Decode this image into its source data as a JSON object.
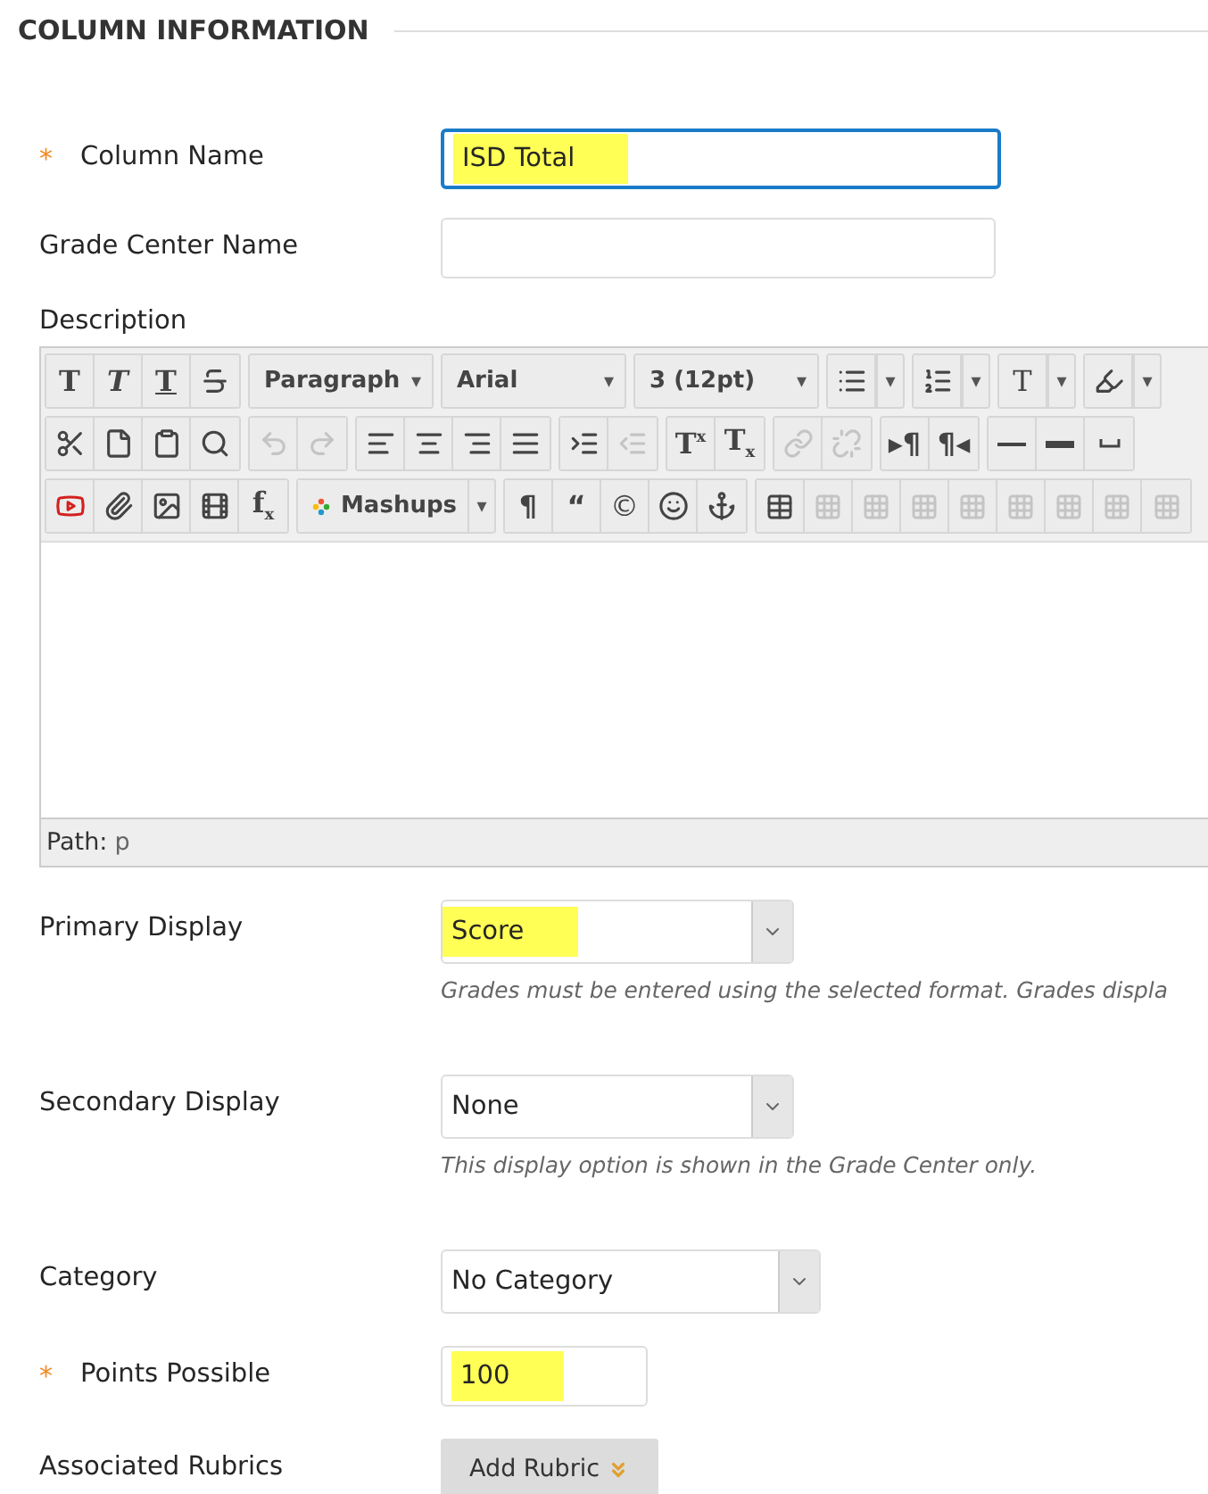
{
  "section": {
    "title": "COLUMN INFORMATION"
  },
  "fields": [
    {
      "kind": "text",
      "label": "Column Name",
      "required_mark": "*",
      "value": "ISD Total",
      "highlighted": true,
      "focused": true
    },
    {
      "kind": "text",
      "label": "Grade Center Name",
      "focused": false
    },
    {
      "kind": "editor",
      "label": "Description"
    },
    {
      "kind": "select",
      "label": "Primary Display",
      "value": "Score",
      "highlighted": true,
      "help": "Grades must be entered using the selected format. Grades displa"
    },
    {
      "kind": "select",
      "label": "Secondary Display",
      "value": "None",
      "highlighted": false,
      "help": "This display option is shown in the Grade Center only."
    },
    {
      "kind": "wideselect",
      "label": "Category",
      "value": "No Category",
      "highlighted": false
    },
    {
      "kind": "number",
      "label": "Points Possible",
      "required_mark": "*",
      "value": "100",
      "highlighted": true,
      "focused": false
    },
    {
      "kind": "button",
      "label": "Associated Rubrics",
      "button": "Add Rubric"
    }
  ],
  "editor": {
    "path_label": "Path:",
    "path_value": "p",
    "toolbar": [
      [
        [
          {
            "kind": "glyph",
            "text": "T"
          },
          {
            "kind": "glyph",
            "text": "T"
          },
          {
            "kind": "glyph",
            "text": "T"
          },
          {
            "kind": "icon",
            "disabled": false
          }
        ],
        [
          {
            "kind": "dropdown",
            "text": "Paragraph",
            "caret": "▾"
          }
        ],
        [
          {
            "kind": "dropdown",
            "text": "Arial",
            "caret": "▾"
          }
        ],
        [
          {
            "kind": "dropdown",
            "text": "3 (12pt)",
            "caret": "▾"
          }
        ],
        [
          {
            "kind": "icon",
            "disabled": false
          },
          {
            "kind": "caret",
            "text": "▾"
          }
        ],
        [
          {
            "kind": "icon",
            "disabled": false
          },
          {
            "kind": "caret",
            "text": "▾"
          }
        ],
        [
          {
            "kind": "glyph",
            "text": "T"
          },
          {
            "kind": "caret",
            "text": "▾"
          }
        ],
        [
          {
            "kind": "icon",
            "disabled": false
          },
          {
            "kind": "caret",
            "text": "▾"
          }
        ]
      ],
      [
        [
          {
            "kind": "icon",
            "disabled": false
          },
          {
            "kind": "icon",
            "disabled": false
          },
          {
            "kind": "icon",
            "disabled": false
          },
          {
            "kind": "icon",
            "disabled": false
          }
        ],
        [
          {
            "kind": "icon",
            "disabled": true
          },
          {
            "kind": "icon",
            "disabled": true
          }
        ],
        [
          {
            "kind": "icon",
            "disabled": false
          },
          {
            "kind": "icon",
            "disabled": false
          },
          {
            "kind": "icon",
            "disabled": false
          },
          {
            "kind": "icon",
            "disabled": false
          }
        ],
        [
          {
            "kind": "icon",
            "disabled": false
          },
          {
            "kind": "icon",
            "disabled": true
          }
        ],
        [
          {
            "kind": "glyph",
            "text": "T$^{x}$"
          },
          {
            "kind": "glyph",
            "text": "T$_{x}$"
          }
        ],
        [
          {
            "kind": "icon",
            "disabled": true
          },
          {
            "kind": "icon",
            "disabled": true
          }
        ],
        [
          {
            "kind": "glyph",
            "text": "▸¶"
          },
          {
            "kind": "glyph",
            "text": "¶◂"
          }
        ],
        [
          {
            "kind": "icon",
            "disabled": false
          },
          {
            "kind": "icon",
            "disabled": false
          },
          {
            "kind": "icon",
            "disabled": false
          }
        ]
      ],
      [
        [
          {
            "kind": "icon",
            "disabled": false
          },
          {
            "kind": "icon",
            "disabled": false
          },
          {
            "kind": "icon",
            "disabled": false
          },
          {
            "kind": "icon",
            "disabled": false
          },
          {
            "kind": "glyph",
            "text": "f$_{x}$"
          }
        ],
        [
          {
            "kind": "logodropdown",
            "text": "Mashups"
          },
          {
            "kind": "caret",
            "text": "▾"
          }
        ],
        [
          {
            "kind": "glyph",
            "text": "¶"
          },
          {
            "kind": "glyph",
            "text": "“"
          },
          {
            "kind": "glyph",
            "text": "©"
          },
          {
            "kind": "icon",
            "disabled": false
          },
          {
            "kind": "icon",
            "disabled": false
          }
        ],
        [
          {
            "kind": "icon",
            "disabled": false
          },
          {
            "kind": "icon",
            "disabled": true
          },
          {
            "kind": "icon",
            "disabled": true
          },
          {
            "kind": "icon",
            "disabled": true
          },
          {
            "kind": "icon",
            "disabled": true
          },
          {
            "kind": "icon",
            "disabled": true
          },
          {
            "kind": "icon",
            "disabled": true
          },
          {
            "kind": "icon",
            "disabled": true
          },
          {
            "kind": "icon",
            "disabled": true
          }
        ]
      ]
    ]
  }
}
